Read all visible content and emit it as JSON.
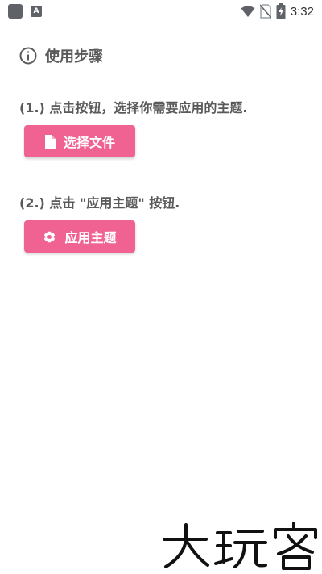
{
  "status_bar": {
    "time": "3:32",
    "notification_badge": "A",
    "icons": [
      "app-square-icon",
      "a-badge-icon",
      "wifi-icon",
      "no-sim-icon",
      "battery-charging-icon"
    ]
  },
  "header": {
    "icon": "info-icon",
    "title": "使用步骤"
  },
  "steps": [
    {
      "text": "(1.) 点击按钮，选择你需要应用的主题.",
      "button_label": "选择文件",
      "button_icon": "file-icon"
    },
    {
      "text": "(2.) 点击 \"应用主题\" 按钮.",
      "button_label": "应用主题",
      "button_icon": "gear-icon"
    }
  ],
  "watermark": {
    "text": "大玩客"
  },
  "colors": {
    "accent": "#f06292",
    "text": "#5a5a5a",
    "background": "#ffffff"
  }
}
